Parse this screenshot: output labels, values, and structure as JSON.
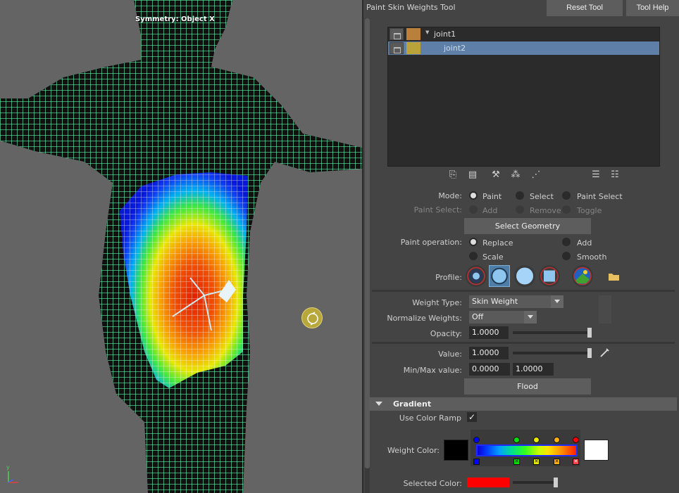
{
  "viewport": {
    "symmetry_label": "Symmetry: Object X",
    "axis_label": "y",
    "mesh_color": "#5cf0a8"
  },
  "panel": {
    "title": "Paint Skin Weights Tool",
    "reset_label": "Reset Tool",
    "help_label": "Tool Help"
  },
  "influences": [
    {
      "name": "joint1",
      "color": "#b8803a",
      "selected": false
    },
    {
      "name": "joint2",
      "color": "#b8a43a",
      "selected": true
    }
  ],
  "toolbar_icons": [
    "copy-weights-icon",
    "paste-weights-icon",
    "weight-hammer-icon",
    "mirror-weights-icon",
    "move-weights-icon",
    "sort-list-icon",
    "flat-list-icon"
  ],
  "mode": {
    "label": "Mode:",
    "options": [
      "Paint",
      "Select",
      "Paint Select"
    ],
    "selected": "Paint"
  },
  "paint_select": {
    "label": "Paint Select:",
    "options": [
      "Add",
      "Remove",
      "Toggle"
    ]
  },
  "select_geometry_label": "Select Geometry",
  "paint_operation": {
    "label": "Paint operation:",
    "options": [
      "Replace",
      "Add",
      "Scale",
      "Smooth"
    ],
    "selected": "Replace"
  },
  "profile": {
    "label": "Profile:",
    "selected_index": 1
  },
  "weight_type": {
    "label": "Weight Type:",
    "value": "Skin Weight"
  },
  "normalize_weights": {
    "label": "Normalize Weights:",
    "value": "Off"
  },
  "opacity": {
    "label": "Opacity:",
    "value": "1.0000",
    "fraction": 1.0
  },
  "value": {
    "label": "Value:",
    "value": "1.0000",
    "fraction": 1.0
  },
  "minmax": {
    "label": "Min/Max value:",
    "min": "0.0000",
    "max": "1.0000"
  },
  "flood_label": "Flood",
  "gradient": {
    "title": "Gradient",
    "use_color_ramp_label": "Use Color Ramp",
    "use_color_ramp": true,
    "weight_color_label": "Weight Color:",
    "ramp_colors": [
      "#0000ff",
      "#00e000",
      "#e8e800",
      "#ffb000",
      "#ff0000"
    ],
    "low_color": "#000000",
    "high_color": "#ffffff",
    "selected_color_label": "Selected Color:",
    "selected_color": "#ff0000"
  }
}
